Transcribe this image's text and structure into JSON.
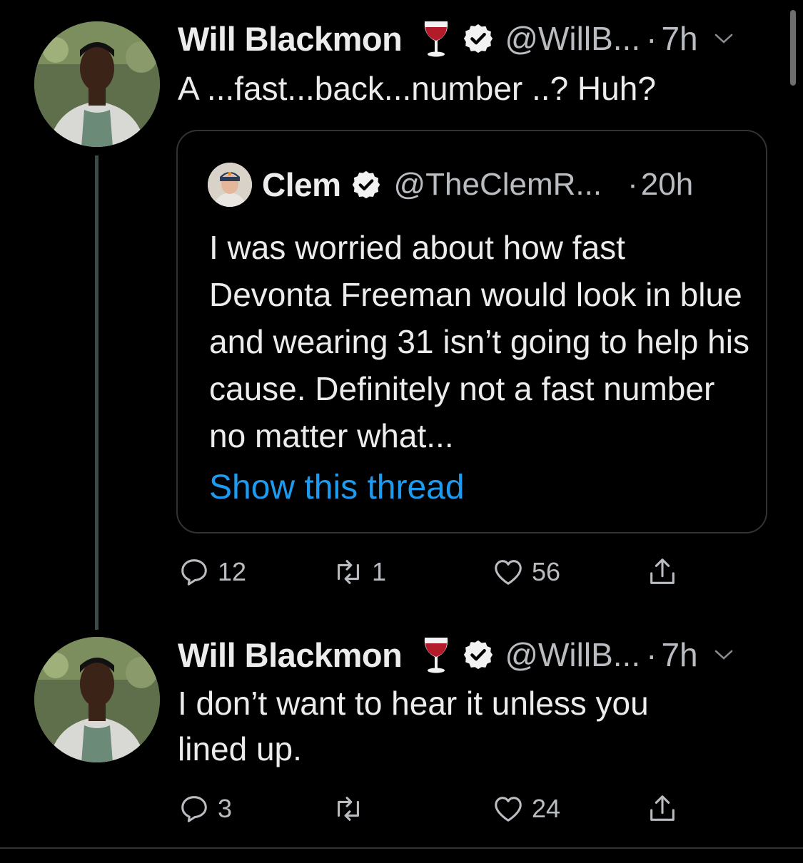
{
  "tweets": [
    {
      "author_name": "Will Blackmon",
      "handle": "@WillB...",
      "separator": "·",
      "time": "7h",
      "text": "A ...fast...back...number ..? Huh?",
      "emoji": "wine-glass-icon",
      "replies": "12",
      "retweets": "1",
      "likes": "56"
    },
    {
      "author_name": "Will Blackmon",
      "handle": "@WillB...",
      "separator": "·",
      "time": "7h",
      "text": "I don’t want to hear it unless you lined up.",
      "emoji": "wine-glass-icon",
      "replies": "3",
      "retweets": "",
      "likes": "24"
    }
  ],
  "quote": {
    "author_name": "Clem",
    "handle": "@TheClemR...",
    "separator": "·",
    "time": "20h",
    "text": "I was worried about how fast Devonta Freeman would look in blue and wearing 31 isn’t going to help his cause. Definitely not a fast number no matter what...",
    "show_thread": "Show this thread"
  },
  "colors": {
    "background": "#000000",
    "text": "#ececec",
    "secondary": "#b9bcc0",
    "link": "#1d9bf0",
    "border": "#2f3336"
  }
}
